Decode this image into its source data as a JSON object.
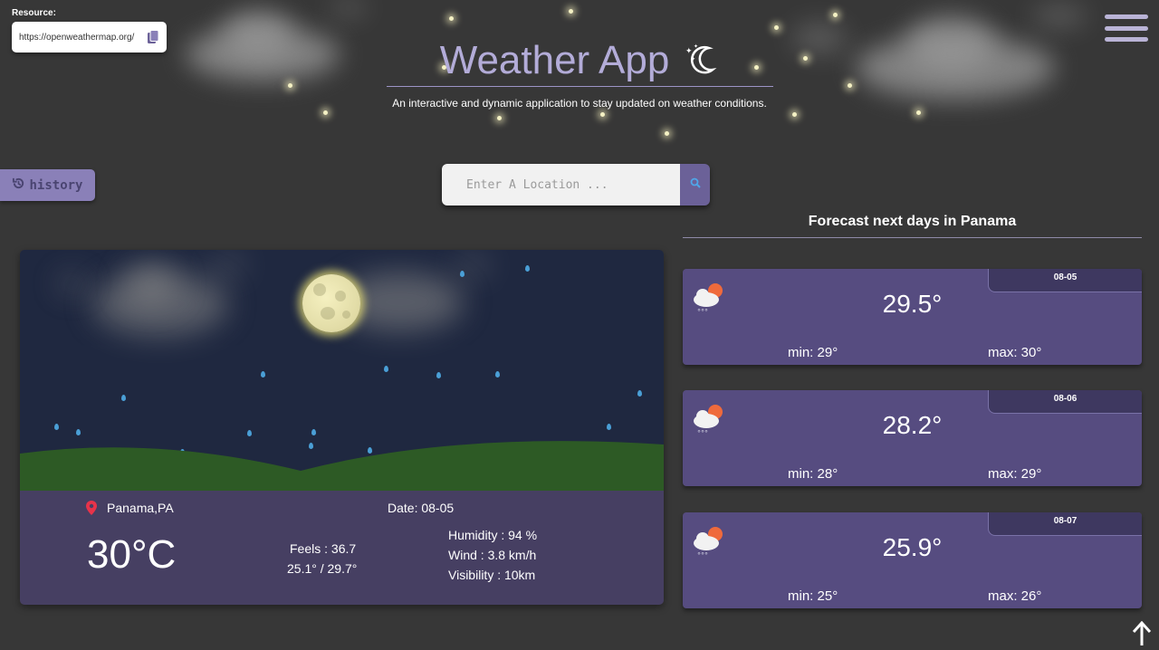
{
  "resource": {
    "label": "Resource:",
    "url": "https://openweathermap.org/"
  },
  "header": {
    "title": "Weather App",
    "subtitle": "An interactive and dynamic application to stay updated on weather conditions."
  },
  "history": {
    "label": "history"
  },
  "search": {
    "placeholder": "Enter A Location ..."
  },
  "current": {
    "location": "Panama,PA",
    "date": "Date: 08-05",
    "temperature": "30°C",
    "feels": "Feels : 36.7",
    "range": "25.1° / 29.7°",
    "humidity": "Humidity : 94 %",
    "wind": "Wind : 3.8 km/h",
    "visibility": "Visibility : 10km"
  },
  "forecast": {
    "title": "Forecast next days in Panama",
    "days": [
      {
        "date": "08-05",
        "temp": "29.5°",
        "min": "min: 29°",
        "max": "max: 30°"
      },
      {
        "date": "08-06",
        "temp": "28.2°",
        "min": "min: 28°",
        "max": "max: 29°"
      },
      {
        "date": "08-07",
        "temp": "25.9°",
        "min": "min: 25°",
        "max": "max: 26°"
      }
    ]
  },
  "icons": {
    "copy": "copy-icon",
    "menu": "hamburger-menu-icon",
    "title": "moon-stars-icon",
    "history": "history-icon",
    "search": "search-icon",
    "location": "location-pin-icon",
    "forecast": "cloud-sun-rain-icon",
    "scroll_top": "arrow-up-icon"
  },
  "colors": {
    "background": "#373737",
    "accent": "#6b6198",
    "card": "#463f62",
    "forecast_card": "#564c80",
    "title": "#b3acd8"
  }
}
